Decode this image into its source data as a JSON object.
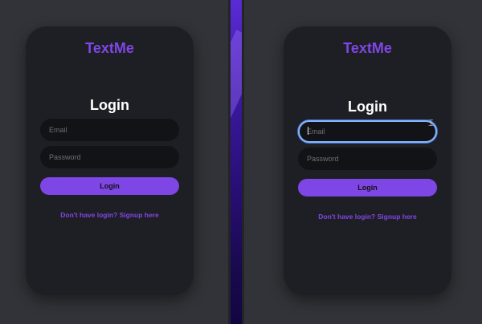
{
  "left_panel": {
    "brand": "TextMe",
    "heading": "Login",
    "email_placeholder": "Email",
    "password_placeholder": "Password",
    "login_button": "Login",
    "signup_link": "Don't have login? Signup here"
  },
  "right_panel": {
    "brand": "TextMe",
    "heading": "Login",
    "email_placeholder": "Email",
    "password_placeholder": "Password",
    "login_button": "Login",
    "signup_link": "Don't have login? Signup here"
  },
  "colors": {
    "accent": "#7f46e6",
    "card_bg": "#1e1f24",
    "field_bg": "#121317",
    "focus_ring": "#8ab4f8"
  },
  "icons": {
    "text_cursor": "text-cursor-icon"
  }
}
